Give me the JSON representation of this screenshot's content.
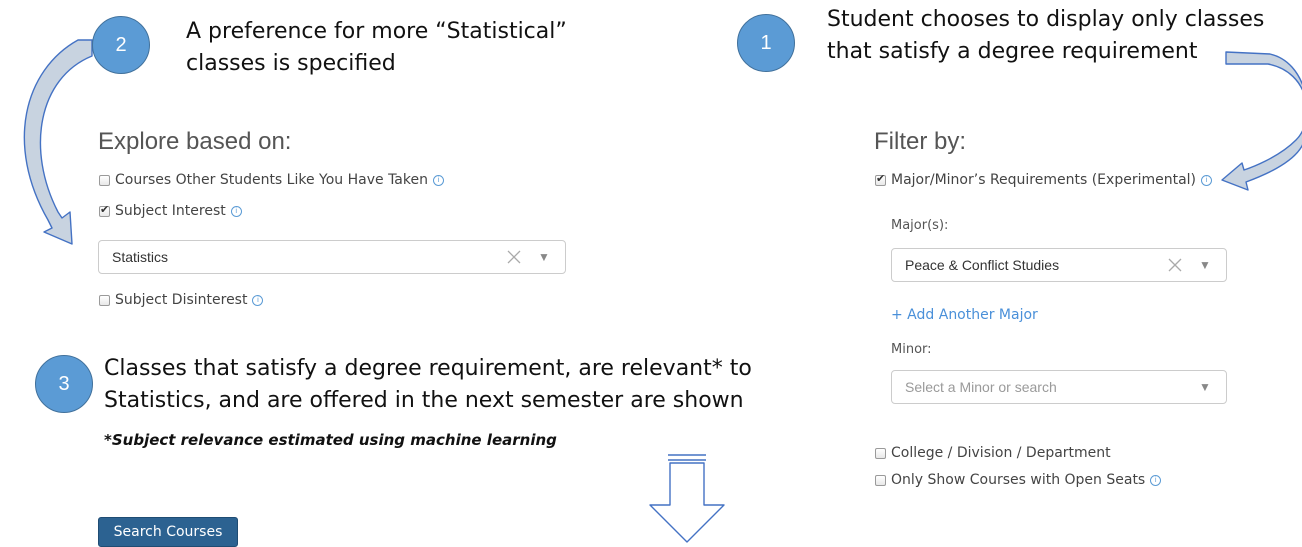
{
  "annotations": {
    "step1": {
      "number": "1",
      "line1": "Student chooses to display only classes",
      "line2": "that satisfy a degree requirement"
    },
    "step2": {
      "number": "2",
      "line1": "A preference for more “Statistical”",
      "line2": "classes is specified"
    },
    "step3": {
      "number": "3",
      "line1": "Classes that satisfy a degree requirement, are relevant* to",
      "line2": "Statistics, and are offered in the next semester are shown",
      "note": "*Subject relevance estimated using machine learning"
    }
  },
  "explore": {
    "title": "Explore based on:",
    "options": [
      {
        "label": "Courses Other Students Like You Have Taken",
        "checked": false
      },
      {
        "label": "Subject Interest",
        "checked": true
      },
      {
        "label": "Subject Disinterest",
        "checked": false
      }
    ],
    "subject_select": {
      "value": "Statistics"
    }
  },
  "filter": {
    "title": "Filter by:",
    "requirements_option": {
      "label": "Major/Minor’s Requirements (Experimental)",
      "checked": true
    },
    "majors_label": "Major(s):",
    "major_select": {
      "value": "Peace & Conflict Studies"
    },
    "add_major_link": "+ Add Another Major",
    "minor_label": "Minor:",
    "minor_select": {
      "placeholder": "Select a Minor or search"
    },
    "college_option": {
      "label": "College / Division / Department",
      "checked": false
    },
    "open_seats_option": {
      "label": "Only Show Courses with Open Seats",
      "checked": false
    }
  },
  "search_button_label": "Search Courses",
  "icons": {
    "checkmark": "check-icon",
    "info": "info-icon",
    "clear": "close-icon",
    "dropdown": "triangle-down-icon"
  },
  "colors": {
    "step_circle": "#5b9bd5",
    "arrow_fill": "#c8d3e0",
    "arrow_stroke": "#4472c4",
    "link": "#4a90d9",
    "button": "#2c6291"
  }
}
